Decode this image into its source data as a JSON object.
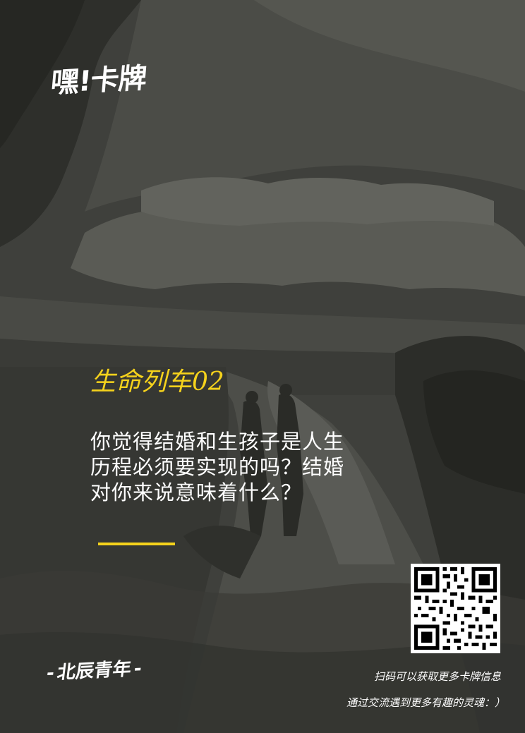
{
  "brand": {
    "logo_text": "嘿!卡牌"
  },
  "card": {
    "title": "生命列车",
    "title_number": "02",
    "question_lines": [
      "你觉得结婚和生孩子是人生",
      "历程必须要实现的吗？结婚",
      "对你来说意味着什么？"
    ]
  },
  "footer": {
    "brand_dash_left": "-",
    "brand_name": "北辰青年",
    "brand_dash_right": "-",
    "scan_line_1": "扫码可以获取更多卡牌信息",
    "scan_line_2": "通过交流遇到更多有趣的灵魂：）"
  },
  "colors": {
    "accent_yellow": "#f5d21c",
    "text_white": "#ffffff",
    "background_dark": "#3d3e3a"
  },
  "icons": {
    "qr_code": "qr-code-icon"
  }
}
